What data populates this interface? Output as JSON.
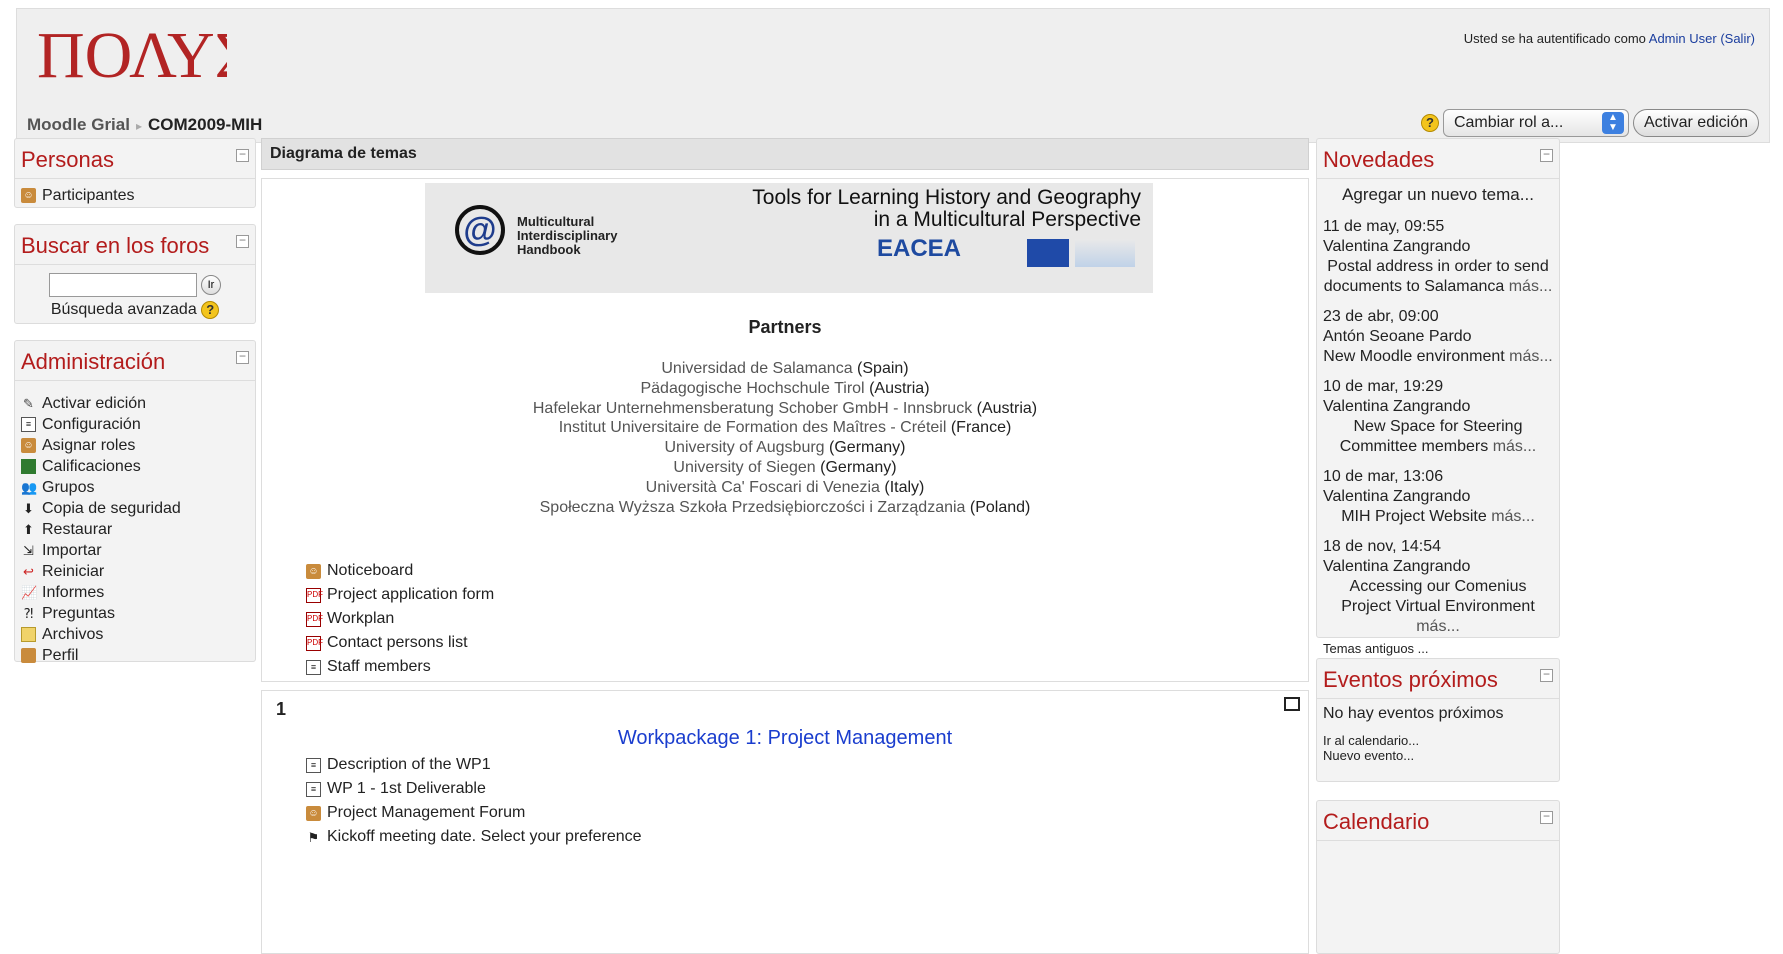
{
  "header": {
    "logo_text": "ΠΟΛΥΣ",
    "login_prefix": "Usted se ha autentificado como",
    "login_user": "Admin User",
    "logout": "(Salir)",
    "breadcrumb": {
      "home": "Moodle Grial",
      "current": "COM2009-MIH"
    },
    "help_glyph": "?",
    "role_select": "Cambiar rol a...",
    "edit_button": "Activar edición"
  },
  "left": {
    "people": {
      "title": "Personas",
      "items": [
        "Participantes"
      ]
    },
    "search": {
      "title": "Buscar en los foros",
      "go": "Ir",
      "advanced": "Búsqueda avanzada"
    },
    "admin": {
      "title": "Administración",
      "items": [
        "Activar edición",
        "Configuración",
        "Asignar roles",
        "Calificaciones",
        "Grupos",
        "Copia de seguridad",
        "Restaurar",
        "Importar",
        "Reiniciar",
        "Informes",
        "Preguntas",
        "Archivos",
        "Perfil"
      ]
    }
  },
  "main": {
    "header": "Diagrama de temas",
    "banner": {
      "title_line1": "Tools for Learning History and Geography",
      "title_line2": "in a Multicultural Perspective",
      "mih_line1": "Multicultural",
      "mih_line2": "Interdisciplinary",
      "mih_line3": "Handbook",
      "eacea": "EACEA"
    },
    "partners_title": "Partners",
    "partners": [
      {
        "name": "Universidad de Salamanca",
        "country": "(Spain)"
      },
      {
        "name": "Pädagogische Hochschule Tirol",
        "country": "(Austria)"
      },
      {
        "name": "Hafelekar Unternehmensberatung Schober GmbH - Innsbruck",
        "country": "(Austria)"
      },
      {
        "name": "Institut Universitaire de Formation des Maîtres - Créteil",
        "country": "(France)"
      },
      {
        "name": "University of Augsburg",
        "country": "(Germany)"
      },
      {
        "name": "University of Siegen",
        "country": "(Germany)"
      },
      {
        "name": "Università Ca' Foscari di Venezia",
        "country": "(Italy)"
      },
      {
        "name": "Społeczna Wyższa Szkoła Przedsiębiorczości i Zarządzania",
        "country": "(Poland)"
      }
    ],
    "resources": [
      "Noticeboard",
      "Project application form",
      "Workplan",
      "Contact persons list",
      "Staff members"
    ],
    "section1": {
      "number": "1",
      "title": "Workpackage 1: Project Management",
      "items": [
        "Description of the WP1",
        "WP 1 - 1st Deliverable",
        "Project Management Forum",
        "Kickoff meeting date. Select your preference"
      ]
    }
  },
  "right": {
    "news": {
      "title": "Novedades",
      "add": "Agregar un nuevo tema...",
      "items": [
        {
          "date": "11 de may, 09:55",
          "author": "Valentina Zangrando",
          "subject": "Postal address in order to send documents to Salamanca",
          "more": "más..."
        },
        {
          "date": "23 de abr, 09:00",
          "author": "Antón Seoane Pardo",
          "subject": "New Moodle environment",
          "more": "más..."
        },
        {
          "date": "10 de mar, 19:29",
          "author": "Valentina Zangrando",
          "subject": "New Space for Steering Committee members",
          "more": "más..."
        },
        {
          "date": "10 de mar, 13:06",
          "author": "Valentina Zangrando",
          "subject": "MIH Project Website",
          "more": "más..."
        },
        {
          "date": "18 de nov, 14:54",
          "author": "Valentina Zangrando",
          "subject": "Accessing our Comenius Project Virtual Environment",
          "more": "más..."
        }
      ],
      "older": "Temas antiguos ..."
    },
    "events": {
      "title": "Eventos próximos",
      "none": "No hay eventos próximos",
      "calendar": "Ir al calendario...",
      "new": "Nuevo evento..."
    },
    "calendar": {
      "title": "Calendario"
    }
  }
}
